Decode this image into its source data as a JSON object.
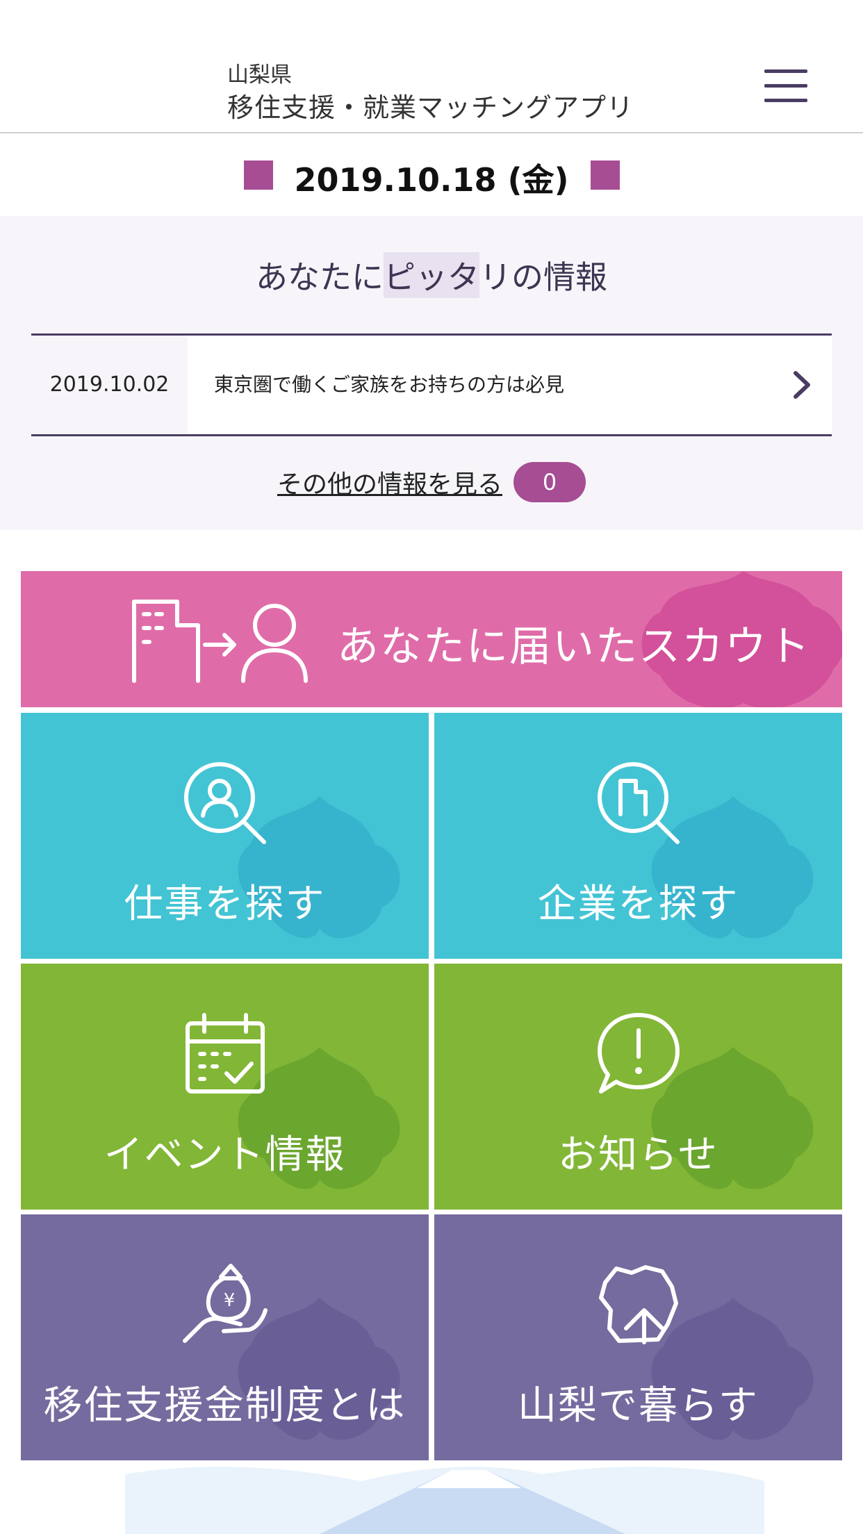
{
  "header": {
    "prefecture": "山梨県",
    "app_name": "移住支援・就業マッチングアプリ"
  },
  "date": {
    "label": "2019.10.18 (金)"
  },
  "info": {
    "title_before": "あなたに",
    "title_highlight": "ピッタ",
    "title_after": "リの情報",
    "items": [
      {
        "date": "2019.10.02",
        "text": "東京圏で働くご家族をお持ちの方は必見"
      }
    ],
    "more_label": "その他の情報を見る",
    "more_count": "0"
  },
  "tiles": {
    "scout": "あなたに届いたスカウト",
    "job": "仕事を探す",
    "company": "企業を探す",
    "event": "イベント情報",
    "news": "お知らせ",
    "support": "移住支援金制度とは",
    "live": "山梨で暮らす"
  },
  "colors": {
    "accent": "#a64d93",
    "navy": "#4a3c62",
    "pink": "#df6ca8",
    "cyan": "#43c4d4",
    "green": "#82b636",
    "purple": "#766b9e"
  }
}
